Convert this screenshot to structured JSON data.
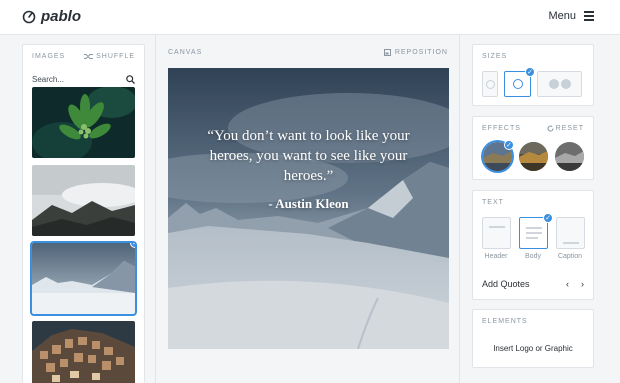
{
  "app": {
    "name": "pablo",
    "menu_label": "Menu"
  },
  "images_panel": {
    "title": "IMAGES",
    "shuffle_label": "SHUFFLE",
    "search_placeholder": "Search...",
    "thumbnails": [
      {
        "subject": "green leaves",
        "selected": false
      },
      {
        "subject": "misty mountain",
        "selected": false
      },
      {
        "subject": "snowy mountains",
        "selected": true
      },
      {
        "subject": "hillside town",
        "selected": false
      }
    ]
  },
  "canvas": {
    "title": "CANVAS",
    "reposition_label": "REPOSITION",
    "quote": "“You don’t want to look like your heroes, you want to see like your heroes.”",
    "author": "- Austin Kleon"
  },
  "sizes_panel": {
    "title": "SIZES",
    "options": [
      "pinterest",
      "instagram",
      "facebook-twitter"
    ],
    "selected": "instagram"
  },
  "effects_panel": {
    "title": "EFFECTS",
    "reset_label": "RESET",
    "selected_index": 0
  },
  "text_panel": {
    "title": "TEXT",
    "styles": [
      {
        "label": "Header"
      },
      {
        "label": "Body"
      },
      {
        "label": "Caption"
      }
    ],
    "selected": "Body",
    "add_quotes_label": "Add Quotes",
    "prev_symbol": "‹",
    "next_symbol": "›"
  },
  "elements_panel": {
    "title": "ELEMENTS",
    "insert_label": "Insert Logo or Graphic"
  },
  "colors": {
    "accent": "#3b8fe0",
    "text": "#2a3036",
    "muted": "#8b96a1",
    "border": "#e1e5e9",
    "background": "#f3f5f7"
  }
}
